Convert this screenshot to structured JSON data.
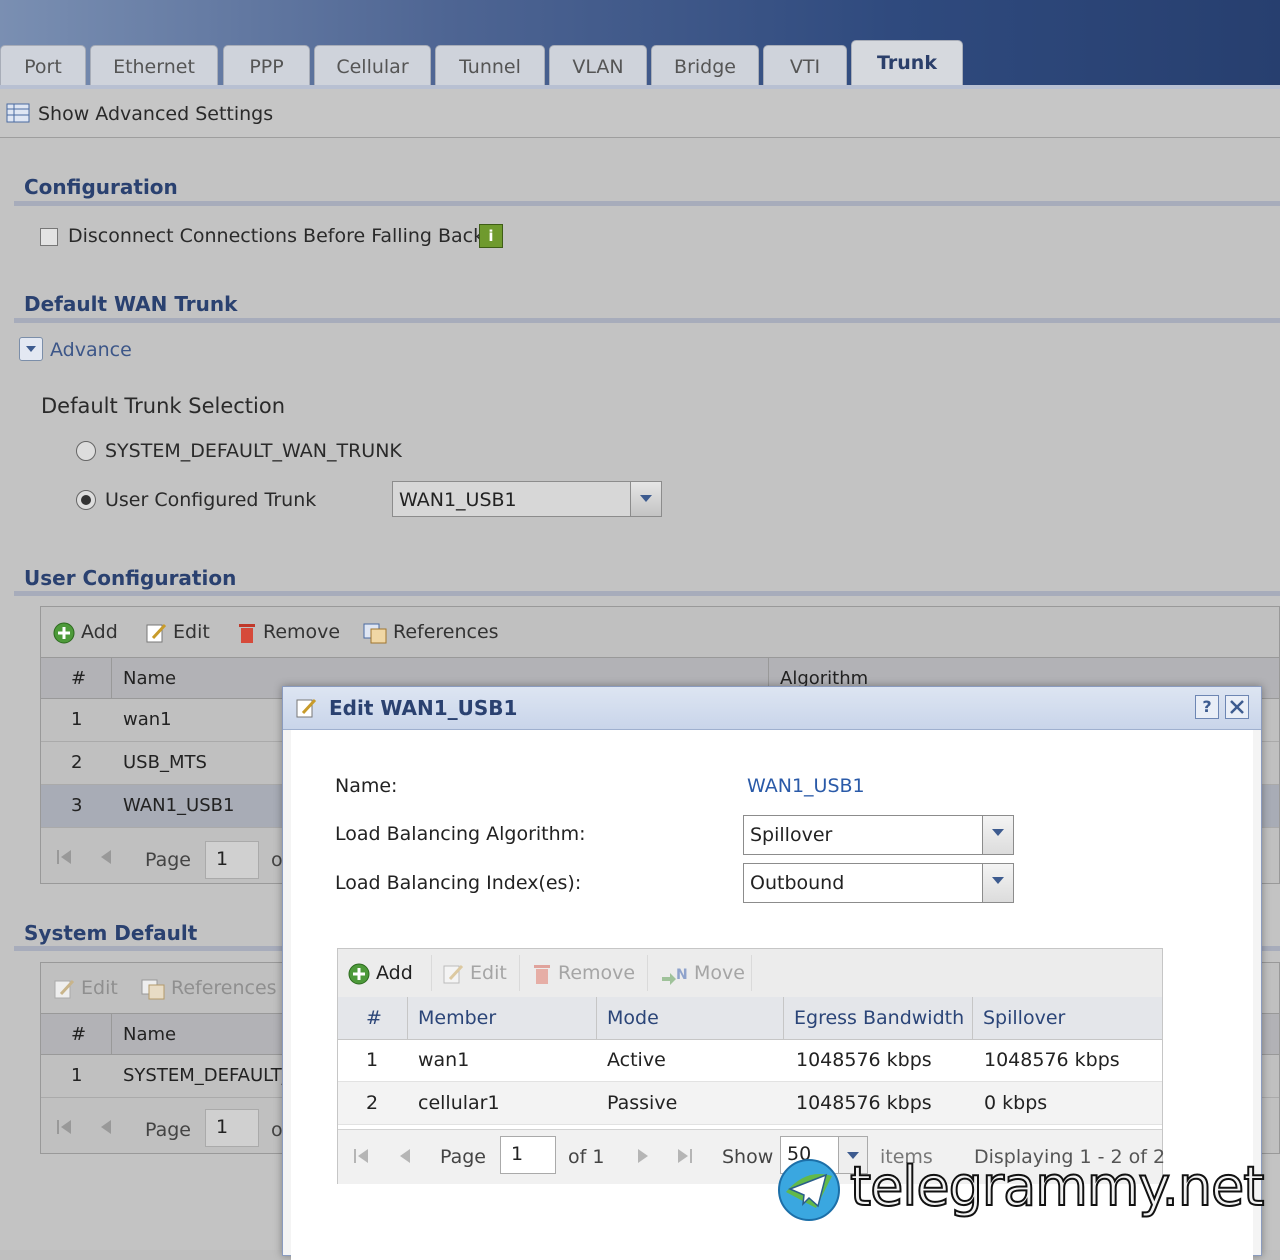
{
  "tabs": [
    "Port",
    "Ethernet",
    "PPP",
    "Cellular",
    "Tunnel",
    "VLAN",
    "Bridge",
    "VTI",
    "Trunk"
  ],
  "active_tab": "Trunk",
  "show_advanced": "Show Advanced Settings",
  "configuration": {
    "title": "Configuration",
    "disconnect_label": "Disconnect Connections Before Falling Back",
    "info_glyph": "i"
  },
  "default_wan_trunk": {
    "title": "Default WAN Trunk",
    "advance_label": "Advance",
    "selection_title": "Default Trunk Selection",
    "option_system": "SYSTEM_DEFAULT_WAN_TRUNK",
    "option_user": "User Configured Trunk",
    "user_trunk_value": "WAN1_USB1"
  },
  "user_configuration": {
    "title": "User Configuration",
    "toolbar": {
      "add": "Add",
      "edit": "Edit",
      "remove": "Remove",
      "references": "References"
    },
    "columns": {
      "num": "#",
      "name": "Name",
      "algorithm": "Algorithm"
    },
    "rows": [
      {
        "num": "1",
        "name": "wan1"
      },
      {
        "num": "2",
        "name": "USB_MTS"
      },
      {
        "num": "3",
        "name": "WAN1_USB1"
      }
    ],
    "pager": {
      "page_label": "Page",
      "page_value": "1",
      "of_partial": "o"
    }
  },
  "system_default": {
    "title": "System Default",
    "toolbar": {
      "edit": "Edit",
      "references": "References"
    },
    "columns": {
      "num": "#",
      "name": "Name"
    },
    "rows": [
      {
        "num": "1",
        "name": "SYSTEM_DEFAULT_"
      }
    ],
    "pager": {
      "page_label": "Page",
      "page_value": "1",
      "of_partial": "o"
    }
  },
  "dialog": {
    "title": "Edit WAN1_USB1",
    "help_glyph": "?",
    "name_label": "Name:",
    "name_value": "WAN1_USB1",
    "algorithm_label": "Load Balancing Algorithm:",
    "algorithm_value": "Spillover",
    "index_label": "Load Balancing Index(es):",
    "index_value": "Outbound",
    "toolbar": {
      "add": "Add",
      "edit": "Edit",
      "remove": "Remove",
      "move": "Move"
    },
    "columns": {
      "num": "#",
      "member": "Member",
      "mode": "Mode",
      "egress": "Egress Bandwidth",
      "spillover": "Spillover"
    },
    "members": [
      {
        "num": "1",
        "member": "wan1",
        "mode": "Active",
        "egress": "1048576 kbps",
        "spillover": "1048576 kbps"
      },
      {
        "num": "2",
        "member": "cellular1",
        "mode": "Passive",
        "egress": "1048576 kbps",
        "spillover": "0 kbps"
      }
    ],
    "pager": {
      "page_label": "Page",
      "page_value": "1",
      "of_label": "of 1",
      "show_label": "Show",
      "show_value": "50",
      "items_label": "items",
      "displaying": "Displaying 1 - 2 of 2"
    }
  },
  "watermark": "telegrammy.net",
  "colors": {
    "accent": "#2a4170",
    "link": "#2a5aa8",
    "top_band": "#2f4a7e"
  }
}
